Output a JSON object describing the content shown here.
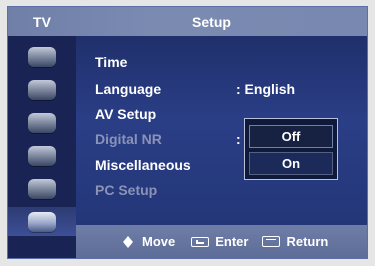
{
  "header": {
    "left": "TV",
    "title": "Setup"
  },
  "menu": {
    "items": [
      {
        "label": "Time",
        "value": ""
      },
      {
        "label": "Language",
        "value": ": English"
      },
      {
        "label": "AV Setup",
        "value": ""
      },
      {
        "label": "Digital NR",
        "value": ":"
      },
      {
        "label": "Miscellaneous",
        "value": ""
      },
      {
        "label": "PC Setup",
        "value": ""
      }
    ],
    "dropdown": {
      "options": [
        "Off",
        "On"
      ],
      "selected": "Off"
    }
  },
  "footer": {
    "move": "Move",
    "enter": "Enter",
    "return": "Return"
  },
  "sidebar": {
    "icons": [
      "picture-icon",
      "sound-icon",
      "channel-icon",
      "setup-icon",
      "input-icon",
      "tools-icon"
    ]
  }
}
